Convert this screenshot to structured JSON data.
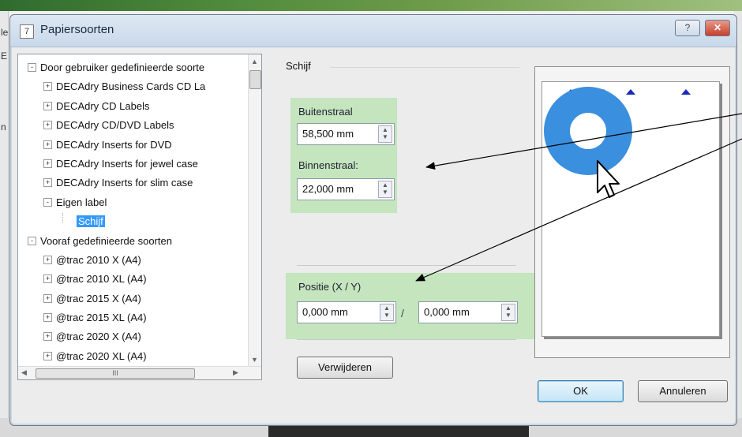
{
  "dialog": {
    "title": "Papiersoorten",
    "icon_glyph": "7",
    "help_glyph": "?",
    "close_glyph": "✕"
  },
  "background": {
    "left_edge_chars": [
      "le",
      "E",
      "n"
    ]
  },
  "tree": {
    "items": [
      {
        "label": "Door gebruiker gedefinieerde soorte",
        "level": 0,
        "exp": "-"
      },
      {
        "label": "DECAdry Business Cards CD La",
        "level": 1,
        "exp": "+"
      },
      {
        "label": "DECAdry CD Labels",
        "level": 1,
        "exp": "+"
      },
      {
        "label": "DECAdry CD/DVD Labels",
        "level": 1,
        "exp": "+"
      },
      {
        "label": "DECAdry Inserts for DVD",
        "level": 1,
        "exp": "+"
      },
      {
        "label": "DECAdry Inserts for jewel case",
        "level": 1,
        "exp": "+"
      },
      {
        "label": "DECAdry Inserts for slim case",
        "level": 1,
        "exp": "+"
      },
      {
        "label": "Eigen label",
        "level": 1,
        "exp": "-"
      },
      {
        "label": "Schijf",
        "level": 2,
        "exp": "",
        "selected": true
      },
      {
        "label": "Vooraf gedefinieerde soorten",
        "level": 0,
        "exp": "-"
      },
      {
        "label": "@trac 2010 X (A4)",
        "level": 1,
        "exp": "+"
      },
      {
        "label": "@trac 2010 XL (A4)",
        "level": 1,
        "exp": "+"
      },
      {
        "label": "@trac 2015 X (A4)",
        "level": 1,
        "exp": "+"
      },
      {
        "label": "@trac 2015 XL (A4)",
        "level": 1,
        "exp": "+"
      },
      {
        "label": "@trac 2020 X (A4)",
        "level": 1,
        "exp": "+"
      },
      {
        "label": "@trac 2020 XL (A4)",
        "level": 1,
        "exp": "+"
      }
    ],
    "hscroll_grip": "III"
  },
  "form": {
    "group_title": "Schijf",
    "buitenstraal_label": "Buitenstraal",
    "buitenstraal_value": "58,500 mm",
    "binnenstraal_label": "Binnenstraal:",
    "binnenstraal_value": "22,000 mm",
    "positie_label": "Positie (X / Y)",
    "pos_x_value": "0,000 mm",
    "pos_separator": "/",
    "pos_y_value": "0,000 mm",
    "delete_button": "Verwijderen"
  },
  "buttons": {
    "ok": "OK",
    "cancel": "Annuleren"
  },
  "colors": {
    "disc": "#3a8fde",
    "highlight": "#bde4b6",
    "selection": "#3399ff",
    "marker": "#1a2bb5"
  }
}
